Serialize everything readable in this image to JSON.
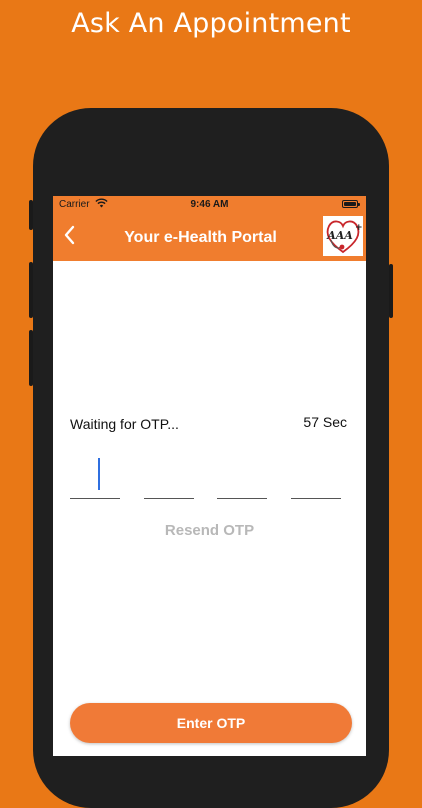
{
  "promo": {
    "caption": "Ask An Appointment"
  },
  "status_bar": {
    "carrier": "Carrier",
    "time": "9:46 AM"
  },
  "nav": {
    "title": "Your e-Health Portal",
    "back_icon": "chevron-left-icon",
    "logo_text": "AAA",
    "logo_plus": "+"
  },
  "otp": {
    "waiting_label": "Waiting for OTP...",
    "countdown": "57 Sec",
    "resend_label": "Resend OTP",
    "digits": [
      "",
      "",
      "",
      ""
    ]
  },
  "actions": {
    "enter_otp_label": "Enter OTP"
  },
  "colors": {
    "background": "#E97816",
    "nav": "#F07D2E",
    "button": "#F07A37",
    "resend_disabled": "#b8b8b8"
  }
}
